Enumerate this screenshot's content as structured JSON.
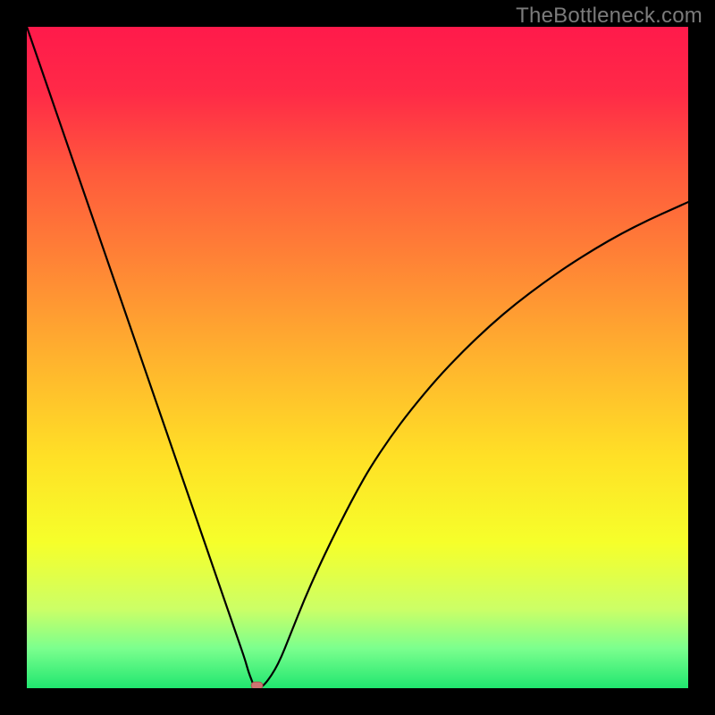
{
  "watermark": "TheBottleneck.com",
  "chart_data": {
    "type": "line",
    "title": "",
    "xlabel": "",
    "ylabel": "",
    "x_range": [
      0,
      100
    ],
    "y_range": [
      0,
      100
    ],
    "x": [
      0,
      2,
      4,
      6,
      8,
      10,
      12,
      14,
      16,
      18,
      20,
      22,
      24,
      26,
      28,
      30,
      31,
      32,
      33,
      33.5,
      34,
      34.3,
      34.6,
      35,
      36,
      38,
      40,
      42,
      44,
      46,
      48,
      50,
      52,
      55,
      58,
      62,
      66,
      70,
      74,
      78,
      82,
      86,
      90,
      94,
      98,
      100
    ],
    "y": [
      100,
      94.2,
      88.4,
      82.6,
      76.8,
      71.0,
      65.2,
      59.4,
      53.6,
      47.8,
      42.0,
      36.2,
      30.4,
      24.6,
      18.8,
      13.0,
      10.1,
      7.2,
      4.3,
      2.5,
      1.2,
      0.4,
      0.0,
      0.0,
      0.5,
      3.5,
      8.5,
      13.5,
      18.0,
      22.2,
      26.2,
      30.0,
      33.5,
      38.0,
      42.0,
      46.8,
      51.0,
      54.8,
      58.2,
      61.2,
      64.0,
      66.5,
      68.8,
      70.8,
      72.6,
      73.5
    ],
    "marker": {
      "x": 34.8,
      "y": 0.4
    },
    "gradient_stops": [
      {
        "offset": 0.0,
        "color": "#ff1a4b"
      },
      {
        "offset": 0.1,
        "color": "#ff2a47"
      },
      {
        "offset": 0.22,
        "color": "#ff5a3c"
      },
      {
        "offset": 0.35,
        "color": "#ff8236"
      },
      {
        "offset": 0.5,
        "color": "#ffb22e"
      },
      {
        "offset": 0.65,
        "color": "#ffe026"
      },
      {
        "offset": 0.78,
        "color": "#f6ff2a"
      },
      {
        "offset": 0.88,
        "color": "#ccff66"
      },
      {
        "offset": 0.94,
        "color": "#7bff8e"
      },
      {
        "offset": 1.0,
        "color": "#20e66f"
      }
    ],
    "curve_color": "#000000",
    "marker_color": "#cf7471"
  }
}
